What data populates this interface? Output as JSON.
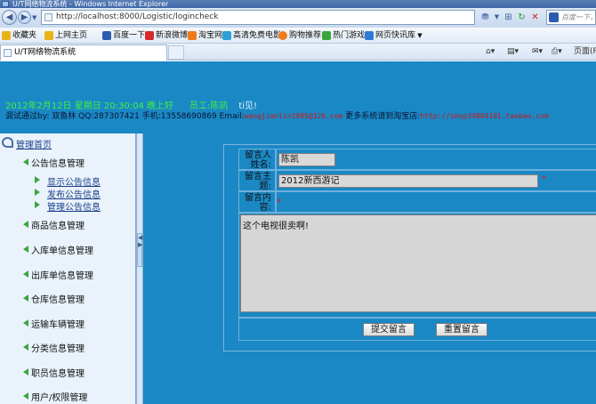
{
  "window": {
    "title": "U/T网络物流系统 - Windows Internet Explorer"
  },
  "address": {
    "url": "http://localhost:8000/Logistic/logincheck"
  },
  "search": {
    "placeholder": "百度一下，你就知道"
  },
  "favorites": [
    {
      "label": "收藏夹",
      "color": "#e8b317"
    },
    {
      "label": "上网主页",
      "color": "#e8b317"
    },
    {
      "label": "百度一下",
      "color": "#2a5db0"
    },
    {
      "label": "新浪微博",
      "color": "#d62a2a"
    },
    {
      "label": "淘宝网",
      "color": "#f07a1a"
    },
    {
      "label": "高清免费电影",
      "color": "#2aa0d6"
    },
    {
      "label": "购物推荐",
      "color": "#f07a1a"
    },
    {
      "label": "热门游戏",
      "color": "#3aa63a"
    },
    {
      "label": "网页快讯库",
      "color": "#2a7ad6"
    }
  ],
  "tab": {
    "title": "U/T网络物流系统"
  },
  "toolbar": {
    "page_label": "页面(P)"
  },
  "header": {
    "datetime": "2012年2月12日 星期日 20:30:04 晚上好",
    "employee": "员工:陈凯",
    "greeting": "ti见!",
    "debug_prefix": "调试通过by: 双鱼林 QQ:287307421 手机:13558690869 Email:",
    "email": "wangjianlin1985@126.com",
    "more_text": " 更多系统请到淘宝店:",
    "shop_url": "http://shop34864101.taobao.com"
  },
  "sidebar": {
    "home": "管理首页",
    "sections": [
      {
        "label": "公告信息管理"
      },
      {
        "label": "商品信息管理"
      },
      {
        "label": "入库单信息管理"
      },
      {
        "label": "出库单信息管理"
      },
      {
        "label": "仓库信息管理"
      },
      {
        "label": "运输车辆管理"
      },
      {
        "label": "分类信息管理"
      },
      {
        "label": "职员信息管理"
      },
      {
        "label": "用户/权限管理"
      }
    ],
    "subitems": [
      {
        "label": "显示公告信息"
      },
      {
        "label": "发布公告信息"
      },
      {
        "label": "管理公告信息"
      }
    ]
  },
  "form": {
    "name_label": "留言人姓名:",
    "name_value": "陈凯",
    "subject_label": "留言主题:",
    "subject_value": "2012新西游记",
    "content_label": "留言内容:",
    "content_value": "这个电视很卖啊!",
    "required_mark": "*",
    "submit_label": "提交留言",
    "reset_label": "重置留言"
  },
  "colors": {
    "page_bg": "#1b89c6",
    "date_text": "#3ef23e",
    "link_red": "#d01515"
  }
}
